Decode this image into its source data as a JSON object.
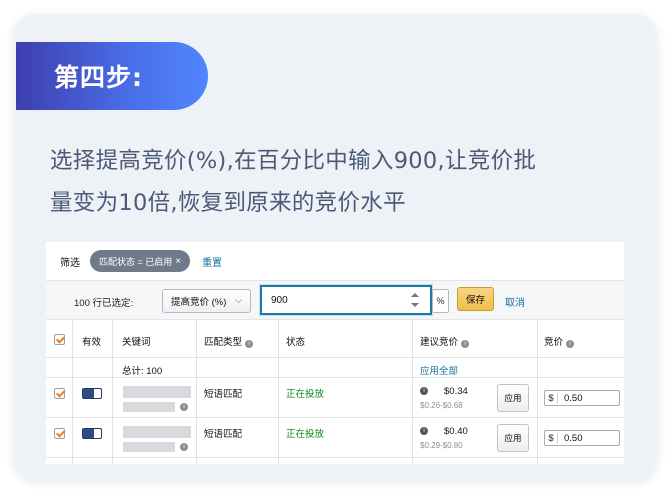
{
  "step": {
    "title": "第四步:"
  },
  "instruction": {
    "line1": "选择提高竞价(%),在百分比中输入900,让竞价批",
    "line2": "量变为10倍,恢复到原来的竞价水平"
  },
  "filter": {
    "label": "筛选",
    "chip": "匹配状态 = 已启用",
    "chip_close": "×",
    "reset": "重置"
  },
  "bulk_edit": {
    "selected_count": "100 行已选定:",
    "action": "提高竞价 (%)",
    "value": "900",
    "unit": "%",
    "save": "保存",
    "cancel": "取消"
  },
  "table": {
    "headers": {
      "active": "有效",
      "keyword": "关键词",
      "match_type": "匹配类型",
      "status": "状态",
      "suggested_bid": "建议竞价",
      "bid": "竞价"
    },
    "total_label": "总计: 100",
    "apply_all": "应用全部",
    "rows": [
      {
        "match_type": "短语匹配",
        "status": "正在投放",
        "suggested": "$0.34",
        "range": "$0.26-$0.68",
        "apply": "应用",
        "currency": "$",
        "bid": "0.50"
      },
      {
        "match_type": "短语匹配",
        "status": "正在投放",
        "suggested": "$0.40",
        "range": "$0.29-$0.80",
        "apply": "应用",
        "currency": "$",
        "bid": "0.50"
      }
    ]
  },
  "colors": {
    "banner_start": "#3e3fae",
    "banner_end": "#4f86ff",
    "instruction_text": "#4b5a78",
    "link": "#1a6ea0",
    "status_green": "#0a8a1a",
    "save_button": "#f0bd47",
    "input_focus": "#1d7ba3"
  }
}
